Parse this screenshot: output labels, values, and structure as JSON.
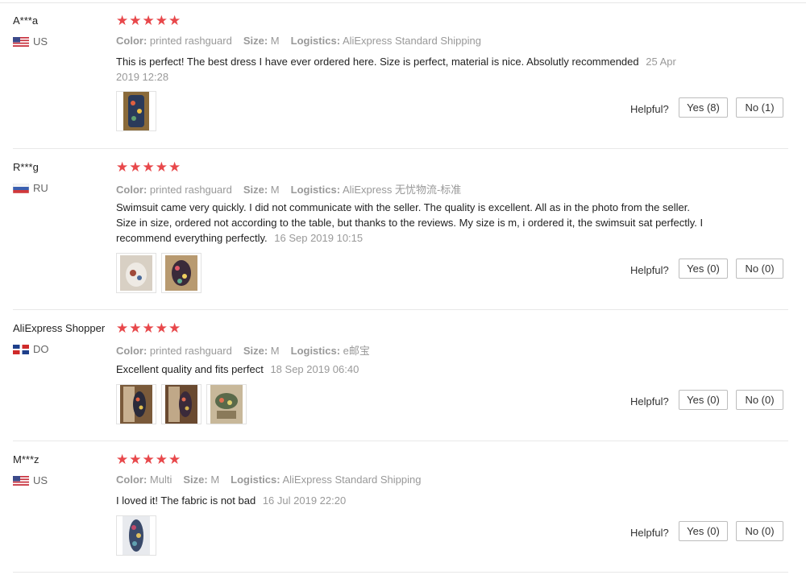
{
  "reviews": [
    {
      "user": "A***a",
      "country": "US",
      "rating": "★★★★★",
      "color_label": "Color:",
      "color": "printed rashguard",
      "size_label": "Size:",
      "size": "M",
      "logistics_label": "Logistics:",
      "logistics": "AliExpress Standard Shipping",
      "text": "This is perfect! The best dress I have ever ordered here. Size is perfect, material is nice. Absolutly recommended",
      "date": "25 Apr 2019 12:28",
      "helpful_label": "Helpful?",
      "yes": "Yes (8)",
      "no": "No (1)"
    },
    {
      "user": "R***g",
      "country": "RU",
      "rating": "★★★★★",
      "color_label": "Color:",
      "color": "printed rashguard",
      "size_label": "Size:",
      "size": "M",
      "logistics_label": "Logistics:",
      "logistics": "AliExpress 无忧物流-标准",
      "text": "Swimsuit came very quickly. I did not communicate with the seller. The quality is excellent. All as in the photo from the seller. Size in size, ordered not according to the table, but thanks to the reviews. My size is m, i ordered it, the swimsuit sat perfectly. I recommend everything perfectly.",
      "date": "16 Sep 2019 10:15",
      "helpful_label": "Helpful?",
      "yes": "Yes (0)",
      "no": "No (0)"
    },
    {
      "user": "AliExpress Shopper",
      "country": "DO",
      "rating": "★★★★★",
      "color_label": "Color:",
      "color": "printed rashguard",
      "size_label": "Size:",
      "size": "M",
      "logistics_label": "Logistics:",
      "logistics": "e邮宝",
      "text": "Excellent quality and fits perfect",
      "date": "18 Sep 2019 06:40",
      "helpful_label": "Helpful?",
      "yes": "Yes (0)",
      "no": "No (0)"
    },
    {
      "user": "M***z",
      "country": "US",
      "rating": "★★★★★",
      "color_label": "Color:",
      "color": "Multi",
      "size_label": "Size:",
      "size": "M",
      "logistics_label": "Logistics:",
      "logistics": "AliExpress Standard Shipping",
      "text": "I loved it! The fabric is not bad",
      "date": "16 Jul 2019 22:20",
      "helpful_label": "Helpful?",
      "yes": "Yes (0)",
      "no": "No (0)"
    }
  ],
  "colors": {
    "star": "#e8484b",
    "muted": "#999999",
    "border": "#bdbdbd"
  }
}
